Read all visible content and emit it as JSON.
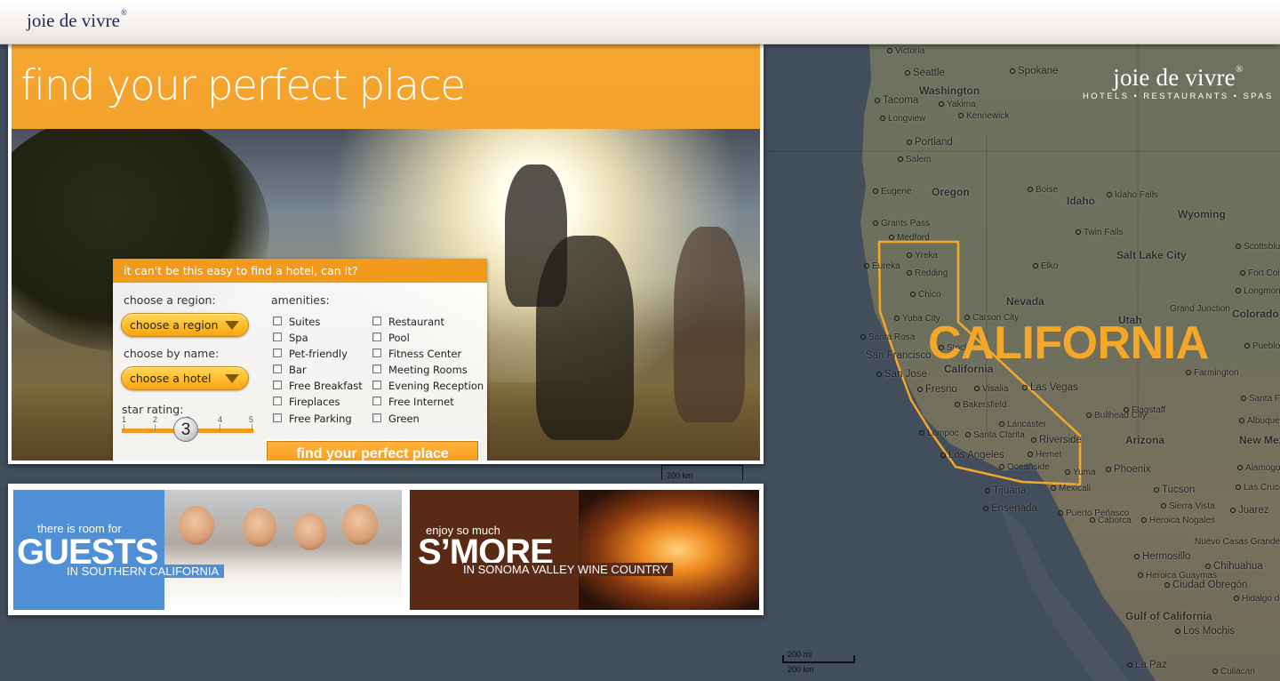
{
  "header": {
    "logo": "joie de vivre",
    "logo_mark": "®"
  },
  "hero": {
    "title": "find your perfect place",
    "search": {
      "headline": "it can't be this easy to find a hotel, can it?",
      "region_label": "choose a region:",
      "region_value": "choose a region",
      "name_label": "choose by name:",
      "name_value": "choose a hotel",
      "star_label": "star rating:",
      "star_ticks": [
        "1",
        "2",
        "3",
        "4",
        "5"
      ],
      "star_value": "3",
      "amenities_label": "amenities:",
      "amenities_left": [
        "Suites",
        "Spa",
        "Pet-friendly",
        "Bar",
        "Free Breakfast",
        "Fireplaces",
        "Free Parking"
      ],
      "amenities_right": [
        "Restaurant",
        "Pool",
        "Fitness Center",
        "Meeting Rooms",
        "Evening Reception",
        "Free Internet",
        "Green"
      ],
      "submit": "find your perfect place"
    },
    "scale": "200 km"
  },
  "promos": [
    {
      "line1": "there is room for",
      "big": "GUESTS",
      "line2": "IN SOUTHERN CALIFORNIA",
      "color": "#4f8fd6"
    },
    {
      "line1": "enjoy so much",
      "big": "S’MORE",
      "line2": "IN SONOMA VALLEY WINE COUNTRY",
      "color": "#5a2a14"
    }
  ],
  "map": {
    "brand": "joie de vivre",
    "brand_mark": "®",
    "tagline": "HOTELS • RESTAURANTS • SPAS",
    "highlight": "CALIFORNIA",
    "highlight_color": "#f5a72a",
    "scale_mi": "200 mi",
    "scale_km": "200 km",
    "labels": {
      "victoria": "Victoria",
      "seattle": "Seattle",
      "spokane": "Spokane",
      "washington": "Washington",
      "tacoma": "Tacoma",
      "yakima": "Yakima",
      "kennewick": "Kennewick",
      "longview": "Longview",
      "portland": "Portland",
      "salem": "Salem",
      "eugene": "Eugene",
      "oregon": "Oregon",
      "boise": "Boise",
      "idaho": "Idaho",
      "idaho_falls": "Idaho Falls",
      "wyoming": "Wyoming",
      "grants_pass": "Grants Pass",
      "medford": "Medford",
      "twin_falls": "Twin Falls",
      "yreka": "Yreka",
      "eureka": "Eureka",
      "redding": "Redding",
      "elko": "Elko",
      "salt_lake": "Salt Lake City",
      "scottsbluff": "Scottsbluff",
      "fort_collins": "Fort Collins",
      "longmont": "Longmont",
      "chico": "Chico",
      "nevada": "Nevada",
      "yuba": "Yuba City",
      "carson": "Carson City",
      "grand_junction": "Grand Junction",
      "colorado": "Colorado",
      "santa_rosa": "Santa Rosa",
      "stockton": "Stockton",
      "utah": "Utah",
      "pueblo": "Pueblo",
      "san_francisco": "San Francisco",
      "california": "California",
      "san_jose": "San Jose",
      "farmington": "Farmington",
      "fresno": "Fresno",
      "visalia": "Visalia",
      "las_vegas": "Las Vegas",
      "santa_fe": "Santa Fe",
      "bakersfield": "Bakersfield",
      "bullhead": "Bullhead City",
      "flagstaff": "Flagstaff",
      "albuquerque": "Albuquerque",
      "lancaster": "Lancaster",
      "lompoc": "Lompoc",
      "santa_clarita": "Santa Clarita",
      "riverside": "Riverside",
      "arizona": "Arizona",
      "new_mexico": "New Mexico",
      "los_angeles": "Los Angeles",
      "hemet": "Hemet",
      "oceanside": "Oceanside",
      "yuma": "Yuma",
      "phoenix": "Phoenix",
      "alamogordo": "Alamogordo",
      "mexicali": "Mexicali",
      "tijuana": "Tijuana",
      "las_cruces": "Las Cruces",
      "tucson": "Tucson",
      "ensenada": "Ensenada",
      "sierra_vista": "Sierra Vista",
      "juarez": "Juarez",
      "puerto_penasco": "Puerto Peñasco",
      "caborca": "Caborca",
      "heroica_nogales": "Heroica Nogales",
      "nuevo_casas": "Nuevo Casas Grandes",
      "hermosillo": "Hermosillo",
      "chihuahua": "Chihuahua",
      "heroica_guaymas": "Heroica Guaymas",
      "ciudad_obregon": "Ciudad Obregón",
      "hidalgo": "Hidalgo del Parral",
      "gulf": "Gulf of California",
      "los_mochis": "Los Mochis",
      "la_paz": "La Paz",
      "culiacan": "Culiacan"
    }
  }
}
